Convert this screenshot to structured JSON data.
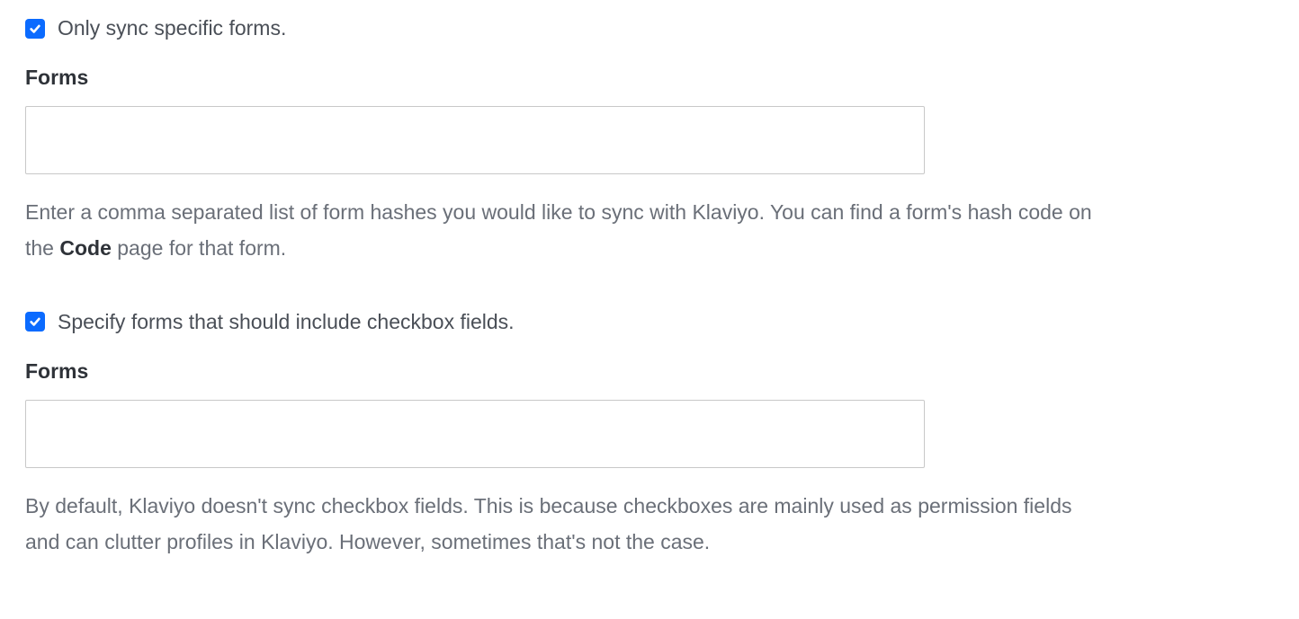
{
  "section1": {
    "checkbox_label": "Only sync specific forms.",
    "checked": true,
    "field_label": "Forms",
    "input_value": "",
    "help_pre": "Enter a comma separated list of form hashes you would like to sync with Klaviyo. You can find a form's hash code on the ",
    "help_strong": "Code",
    "help_post": " page for that form."
  },
  "section2": {
    "checkbox_label": "Specify forms that should include checkbox fields.",
    "checked": true,
    "field_label": "Forms",
    "input_value": "",
    "help_text": "By default, Klaviyo doesn't sync checkbox fields. This is because checkboxes are mainly used as permission fields and can clutter profiles in Klaviyo. However, sometimes that's not the case."
  }
}
